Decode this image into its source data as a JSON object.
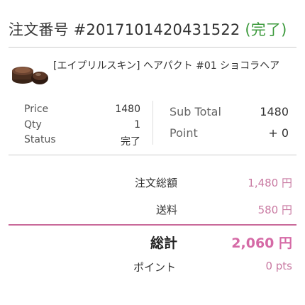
{
  "order": {
    "title": "注文番号 #2017101420431522",
    "status": "(完了)"
  },
  "product": {
    "image_icon": "cosmetic-compact-image",
    "name": "[エイプリルスキン] ヘアパクト #01 ショコラヘア"
  },
  "details": {
    "price_label": "Price",
    "price_value": "1480",
    "qty_label": "Qty",
    "qty_value": "1",
    "status_label": "Status",
    "status_value": "完了"
  },
  "summary": {
    "subtotal_label": "Sub Total",
    "subtotal_value": "1480",
    "point_label": "Point",
    "point_value": "+ 0"
  },
  "totals": {
    "order_total_label": "注文総額",
    "order_total_value": "1,480 円",
    "shipping_label": "送料",
    "shipping_value": "580 円",
    "grand_total_label": "総計",
    "grand_total_value": "2,060 円",
    "points_label": "ポイント",
    "points_value": "0 pts"
  },
  "colors": {
    "status_green": "#3c9a3c",
    "accent_pink": "#d56aa6",
    "divider_pink": "#c96a9a"
  }
}
